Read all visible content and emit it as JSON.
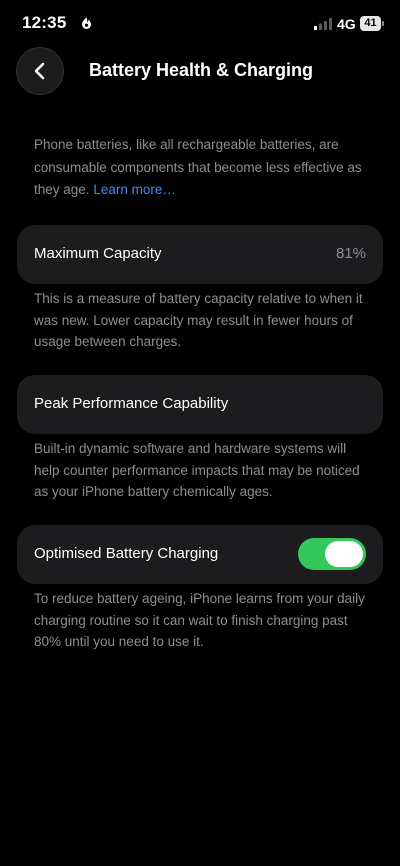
{
  "status_bar": {
    "time": "12:35",
    "network": "4G",
    "battery_level": "41"
  },
  "header": {
    "back_icon": "chevron-left-icon",
    "title": "Battery Health & Charging"
  },
  "intro": {
    "text": "Phone batteries, like all rechargeable batteries, are consumable components that become less effective as they age.",
    "link": "Learn more…"
  },
  "maximum_capacity": {
    "label": "Maximum Capacity",
    "value": "81%",
    "footnote": "This is a measure of battery capacity relative to when it was new. Lower capacity may result in fewer hours of usage between charges."
  },
  "peak_performance": {
    "label": "Peak Performance Capability",
    "footnote": "Built-in dynamic software and hardware systems will help counter performance impacts that may be noticed as your iPhone battery chemically ages."
  },
  "optimised_charging": {
    "label": "Optimised Battery Charging",
    "enabled": true,
    "footnote": "To reduce battery ageing, iPhone learns from your daily charging routine so it can wait to finish charging past 80% until you need to use it."
  },
  "colors": {
    "background": "#000000",
    "card": "#1c1c1e",
    "secondary_text": "#8e8e93",
    "link": "#3d8ef5",
    "toggle_on": "#34c759"
  }
}
